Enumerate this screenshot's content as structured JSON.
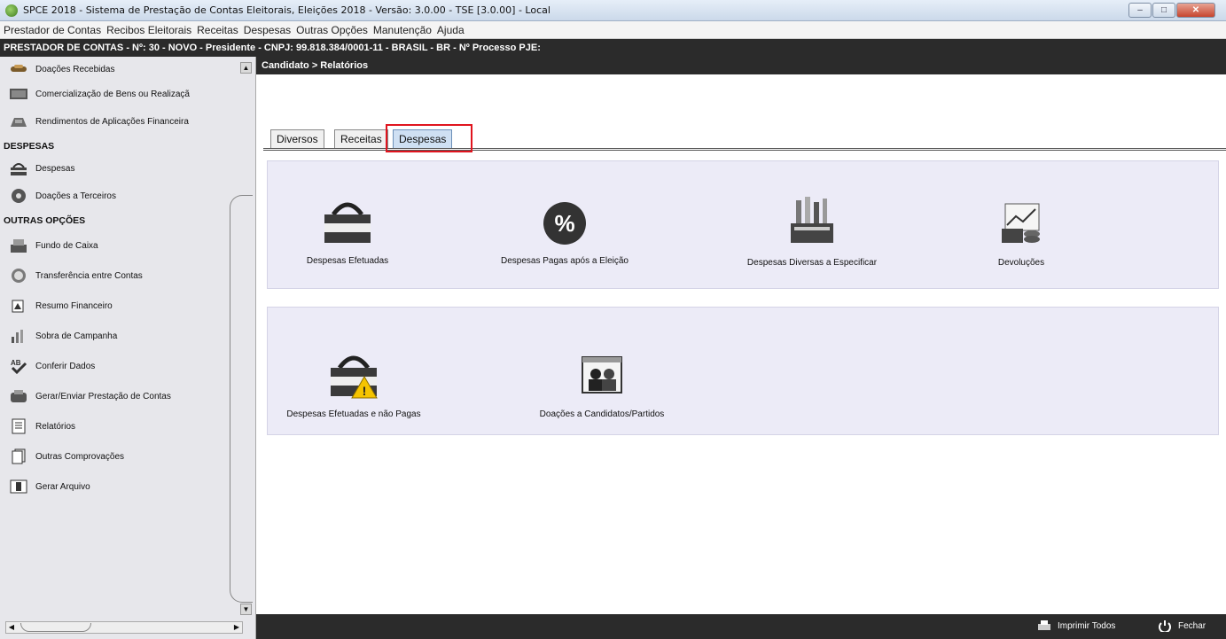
{
  "window": {
    "title": "SPCE 2018 - Sistema de Prestação de Contas Eleitorais, Eleições 2018 - Versão: 3.0.00  -  TSE [3.0.00] - Local"
  },
  "menu": [
    "Prestador de Contas",
    "Recibos Eleitorais",
    "Receitas",
    "Despesas",
    "Outras Opções",
    "Manutenção",
    "Ajuda"
  ],
  "infobar": "PRESTADOR DE CONTAS - Nº: 30 - NOVO - Presidente - CNPJ: 99.818.384/0001-11 - BRASIL - BR - Nº Processo PJE:",
  "sidebar": {
    "items_top": [
      {
        "label": "Doações Recebidas",
        "icon": "handshake-icon"
      },
      {
        "label": "Comercialização de Bens ou Realizaçã",
        "icon": "goods-icon"
      },
      {
        "label": "Rendimentos de Aplicações Financeira",
        "icon": "investment-icon"
      }
    ],
    "section_despesas": "DESPESAS",
    "items_despesas": [
      {
        "label": "Despesas",
        "icon": "bag-icon"
      },
      {
        "label": "Doações a Terceiros",
        "icon": "cd-icon"
      }
    ],
    "section_outras": "OUTRAS OPÇÕES",
    "items_outras": [
      {
        "label": "Fundo de Caixa",
        "icon": "register-icon"
      },
      {
        "label": "Transferência entre Contas",
        "icon": "transfer-icon"
      },
      {
        "label": "Resumo Financeiro",
        "icon": "summary-icon"
      },
      {
        "label": "Sobra de Campanha",
        "icon": "surplus-icon"
      },
      {
        "label": "Conferir Dados",
        "icon": "check-data-icon"
      },
      {
        "label": "Gerar/Enviar Prestação de Contas",
        "icon": "send-icon"
      },
      {
        "label": "Relatórios",
        "icon": "report-icon"
      },
      {
        "label": "Outras Comprovações",
        "icon": "documents-icon"
      },
      {
        "label": "Gerar Arquivo",
        "icon": "archive-icon"
      }
    ]
  },
  "breadcrumb": "Candidato > Relatórios",
  "tabs": [
    {
      "label": "Diversos",
      "active": false
    },
    {
      "label": "Receitas",
      "active": false
    },
    {
      "label": "Despesas",
      "active": true
    }
  ],
  "tiles_row1": [
    {
      "label": "Despesas Efetuadas",
      "icon": "bag-icon"
    },
    {
      "label": "Despesas Pagas após a Eleição",
      "icon": "percent-icon"
    },
    {
      "label": "Despesas Diversas a Especificar",
      "icon": "tools-box-icon"
    },
    {
      "label": "Devoluções",
      "icon": "money-chart-icon"
    }
  ],
  "tiles_row2": [
    {
      "label": "Despesas Efetuadas e não Pagas",
      "icon": "bag-warning-icon"
    },
    {
      "label": "Doações a Candidatos/Partidos",
      "icon": "people-folder-icon"
    }
  ],
  "statusbar": {
    "print_all": "Imprimir Todos",
    "close": "Fechar"
  },
  "colors": {
    "dark_bar": "#2b2b2b",
    "panel_bg": "#ecebf7",
    "highlight": "#e0141e",
    "active_tab": "#cfe0f3"
  }
}
